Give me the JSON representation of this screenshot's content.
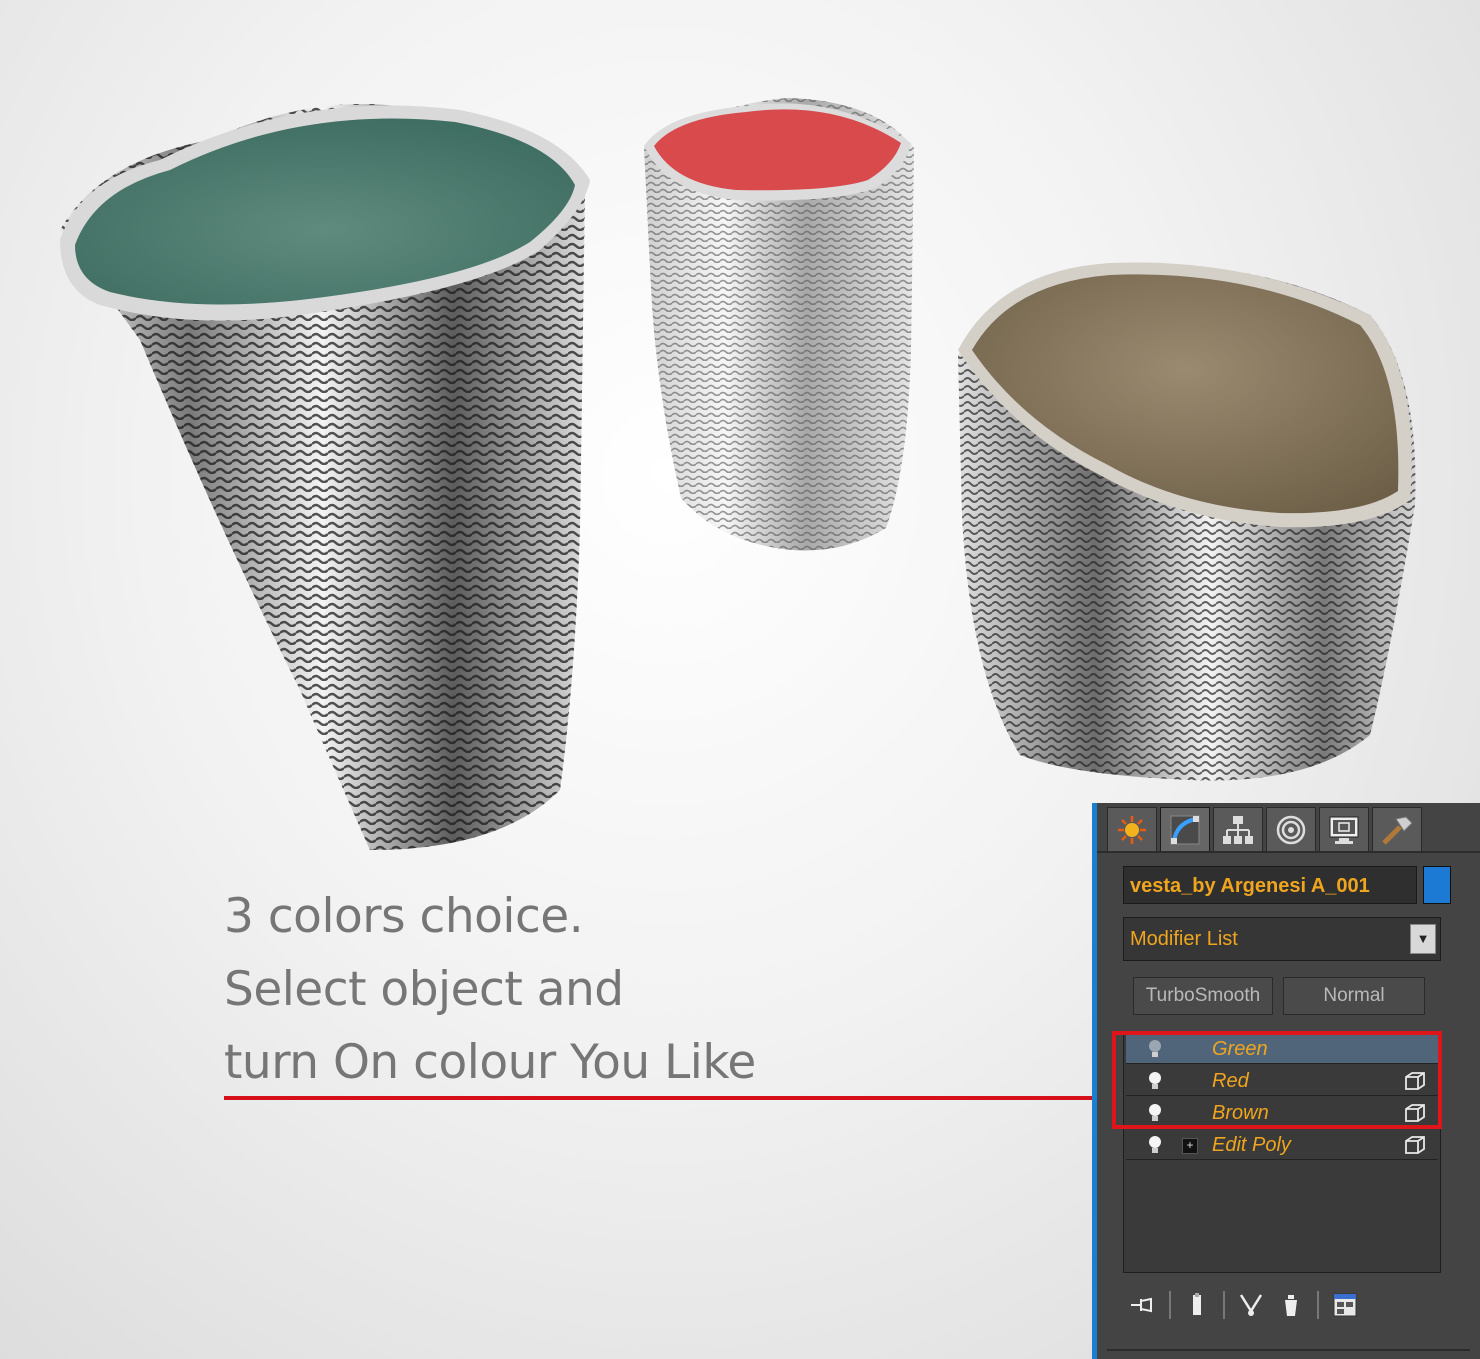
{
  "caption": {
    "line1": "3 colors choice.",
    "line2": "Select object and",
    "line3": "turn On colour You Like"
  },
  "panel": {
    "tabs": [
      "create-icon",
      "modify-icon",
      "hierarchy-icon",
      "motion-icon",
      "display-icon",
      "utilities-icon"
    ],
    "object_name": "vesta_by Argenesi A_001",
    "modifier_list": "Modifier List",
    "buttons": {
      "turbosmooth": "TurboSmooth",
      "normal": "Normal"
    },
    "stack": [
      {
        "label": "Green",
        "selected": true
      },
      {
        "label": "Red",
        "selected": false
      },
      {
        "label": "Brown",
        "selected": false
      },
      {
        "label": "Edit Poly",
        "selected": false
      }
    ],
    "colors": {
      "accent": "#1a7fd0",
      "label": "#f0a51e",
      "highlight": "#e0151c"
    }
  },
  "vase_colors": {
    "green": "#4f7d70",
    "red": "#d84a4c",
    "brown": "#8a7a62"
  }
}
